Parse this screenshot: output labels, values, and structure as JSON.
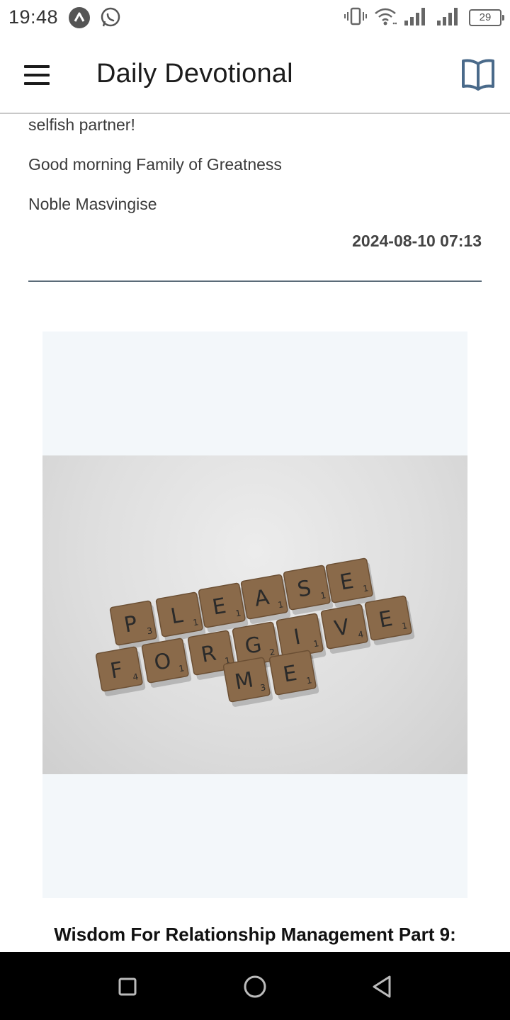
{
  "status_bar": {
    "time": "19:48",
    "battery": "29",
    "icons": [
      "app-notification-icon",
      "whatsapp-icon",
      "vibrate-icon",
      "wifi-icon",
      "signal-icon",
      "signal-icon",
      "battery-icon"
    ]
  },
  "app_bar": {
    "title": "Daily Devotional",
    "menu_icon": "hamburger-menu-icon",
    "book_icon": "open-book-icon"
  },
  "post": {
    "paragraphs": [
      "selfish partner!",
      "Good morning Family of Greatness",
      "Noble Masvingise"
    ],
    "timestamp": "2024-08-10 07:13"
  },
  "next_post": {
    "image_tiles": [
      {
        "letter": "P",
        "score": "3"
      },
      {
        "letter": "L",
        "score": "1"
      },
      {
        "letter": "E",
        "score": "1"
      },
      {
        "letter": "A",
        "score": "1"
      },
      {
        "letter": "S",
        "score": "1"
      },
      {
        "letter": "E",
        "score": "1"
      },
      {
        "letter": "F",
        "score": "4"
      },
      {
        "letter": "O",
        "score": "1"
      },
      {
        "letter": "R",
        "score": "1"
      },
      {
        "letter": "G",
        "score": "2"
      },
      {
        "letter": "I",
        "score": "1"
      },
      {
        "letter": "V",
        "score": "4"
      },
      {
        "letter": "E",
        "score": "1"
      },
      {
        "letter": "M",
        "score": "3"
      },
      {
        "letter": "E",
        "score": "1"
      }
    ],
    "title": "Wisdom For Relationship Management Part 9:"
  },
  "colors": {
    "accent": "#4a6a8a",
    "divider": "#5b6b78",
    "image_background": "#f3f7fa",
    "tile": "#8a6a4a"
  }
}
